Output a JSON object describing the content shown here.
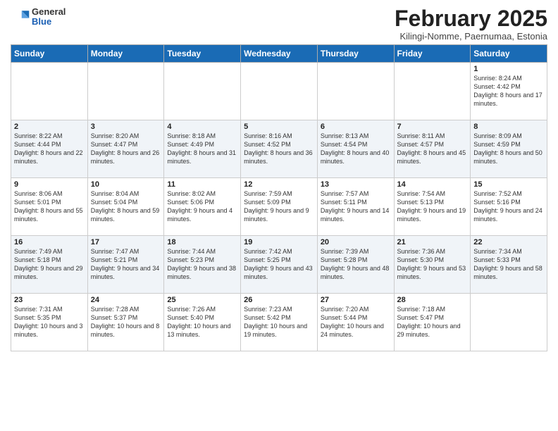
{
  "header": {
    "logo_general": "General",
    "logo_blue": "Blue",
    "month_title": "February 2025",
    "subtitle": "Kilingi-Nomme, Paernumaa, Estonia"
  },
  "weekdays": [
    "Sunday",
    "Monday",
    "Tuesday",
    "Wednesday",
    "Thursday",
    "Friday",
    "Saturday"
  ],
  "weeks": [
    [
      {
        "day": "",
        "info": ""
      },
      {
        "day": "",
        "info": ""
      },
      {
        "day": "",
        "info": ""
      },
      {
        "day": "",
        "info": ""
      },
      {
        "day": "",
        "info": ""
      },
      {
        "day": "",
        "info": ""
      },
      {
        "day": "1",
        "info": "Sunrise: 8:24 AM\nSunset: 4:42 PM\nDaylight: 8 hours and 17 minutes."
      }
    ],
    [
      {
        "day": "2",
        "info": "Sunrise: 8:22 AM\nSunset: 4:44 PM\nDaylight: 8 hours and 22 minutes."
      },
      {
        "day": "3",
        "info": "Sunrise: 8:20 AM\nSunset: 4:47 PM\nDaylight: 8 hours and 26 minutes."
      },
      {
        "day": "4",
        "info": "Sunrise: 8:18 AM\nSunset: 4:49 PM\nDaylight: 8 hours and 31 minutes."
      },
      {
        "day": "5",
        "info": "Sunrise: 8:16 AM\nSunset: 4:52 PM\nDaylight: 8 hours and 36 minutes."
      },
      {
        "day": "6",
        "info": "Sunrise: 8:13 AM\nSunset: 4:54 PM\nDaylight: 8 hours and 40 minutes."
      },
      {
        "day": "7",
        "info": "Sunrise: 8:11 AM\nSunset: 4:57 PM\nDaylight: 8 hours and 45 minutes."
      },
      {
        "day": "8",
        "info": "Sunrise: 8:09 AM\nSunset: 4:59 PM\nDaylight: 8 hours and 50 minutes."
      }
    ],
    [
      {
        "day": "9",
        "info": "Sunrise: 8:06 AM\nSunset: 5:01 PM\nDaylight: 8 hours and 55 minutes."
      },
      {
        "day": "10",
        "info": "Sunrise: 8:04 AM\nSunset: 5:04 PM\nDaylight: 8 hours and 59 minutes."
      },
      {
        "day": "11",
        "info": "Sunrise: 8:02 AM\nSunset: 5:06 PM\nDaylight: 9 hours and 4 minutes."
      },
      {
        "day": "12",
        "info": "Sunrise: 7:59 AM\nSunset: 5:09 PM\nDaylight: 9 hours and 9 minutes."
      },
      {
        "day": "13",
        "info": "Sunrise: 7:57 AM\nSunset: 5:11 PM\nDaylight: 9 hours and 14 minutes."
      },
      {
        "day": "14",
        "info": "Sunrise: 7:54 AM\nSunset: 5:13 PM\nDaylight: 9 hours and 19 minutes."
      },
      {
        "day": "15",
        "info": "Sunrise: 7:52 AM\nSunset: 5:16 PM\nDaylight: 9 hours and 24 minutes."
      }
    ],
    [
      {
        "day": "16",
        "info": "Sunrise: 7:49 AM\nSunset: 5:18 PM\nDaylight: 9 hours and 29 minutes."
      },
      {
        "day": "17",
        "info": "Sunrise: 7:47 AM\nSunset: 5:21 PM\nDaylight: 9 hours and 34 minutes."
      },
      {
        "day": "18",
        "info": "Sunrise: 7:44 AM\nSunset: 5:23 PM\nDaylight: 9 hours and 38 minutes."
      },
      {
        "day": "19",
        "info": "Sunrise: 7:42 AM\nSunset: 5:25 PM\nDaylight: 9 hours and 43 minutes."
      },
      {
        "day": "20",
        "info": "Sunrise: 7:39 AM\nSunset: 5:28 PM\nDaylight: 9 hours and 48 minutes."
      },
      {
        "day": "21",
        "info": "Sunrise: 7:36 AM\nSunset: 5:30 PM\nDaylight: 9 hours and 53 minutes."
      },
      {
        "day": "22",
        "info": "Sunrise: 7:34 AM\nSunset: 5:33 PM\nDaylight: 9 hours and 58 minutes."
      }
    ],
    [
      {
        "day": "23",
        "info": "Sunrise: 7:31 AM\nSunset: 5:35 PM\nDaylight: 10 hours and 3 minutes."
      },
      {
        "day": "24",
        "info": "Sunrise: 7:28 AM\nSunset: 5:37 PM\nDaylight: 10 hours and 8 minutes."
      },
      {
        "day": "25",
        "info": "Sunrise: 7:26 AM\nSunset: 5:40 PM\nDaylight: 10 hours and 13 minutes."
      },
      {
        "day": "26",
        "info": "Sunrise: 7:23 AM\nSunset: 5:42 PM\nDaylight: 10 hours and 19 minutes."
      },
      {
        "day": "27",
        "info": "Sunrise: 7:20 AM\nSunset: 5:44 PM\nDaylight: 10 hours and 24 minutes."
      },
      {
        "day": "28",
        "info": "Sunrise: 7:18 AM\nSunset: 5:47 PM\nDaylight: 10 hours and 29 minutes."
      },
      {
        "day": "",
        "info": ""
      }
    ]
  ]
}
